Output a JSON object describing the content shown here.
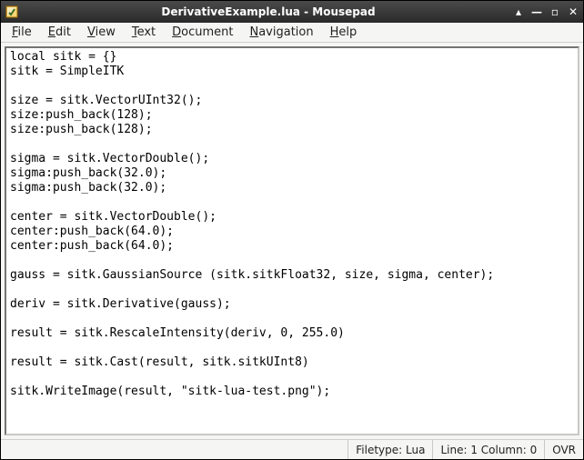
{
  "window": {
    "title": "DerivativeExample.lua - Mousepad"
  },
  "titlebar_controls": {
    "rollup": "▴",
    "minimize": "—",
    "maximize": "▫",
    "close": "✕"
  },
  "menubar": {
    "file": {
      "ul": "F",
      "rest": "ile"
    },
    "edit": {
      "ul": "E",
      "rest": "dit"
    },
    "view": {
      "ul": "V",
      "rest": "iew"
    },
    "text": {
      "ul": "T",
      "rest": "ext"
    },
    "document": {
      "ul": "D",
      "rest": "ocument"
    },
    "navigation": {
      "ul": "N",
      "rest": "avigation"
    },
    "help": {
      "ul": "H",
      "rest": "elp"
    }
  },
  "editor": {
    "content": "local sitk = {}\nsitk = SimpleITK\n\nsize = sitk.VectorUInt32();\nsize:push_back(128);\nsize:push_back(128);\n\nsigma = sitk.VectorDouble();\nsigma:push_back(32.0);\nsigma:push_back(32.0);\n\ncenter = sitk.VectorDouble();\ncenter:push_back(64.0);\ncenter:push_back(64.0);\n\ngauss = sitk.GaussianSource (sitk.sitkFloat32, size, sigma, center);\n\nderiv = sitk.Derivative(gauss);\n\nresult = sitk.RescaleIntensity(deriv, 0, 255.0)\n\nresult = sitk.Cast(result, sitk.sitkUInt8)\n\nsitk.WriteImage(result, \"sitk-lua-test.png\");"
  },
  "statusbar": {
    "filetype": "Filetype: Lua",
    "position": "Line: 1 Column: 0",
    "mode": "OVR"
  }
}
